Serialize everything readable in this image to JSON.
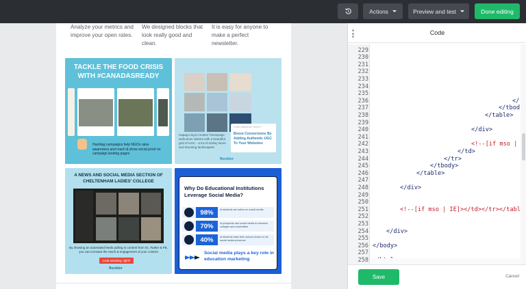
{
  "toolbar": {
    "history_icon": "history-icon",
    "actions_label": "Actions",
    "preview_label": "Preview and test",
    "done_label": "Done editing"
  },
  "email": {
    "intro": [
      "Analyze your metrics and improve your open rates.",
      "We designed blocks that look really good and clean.",
      "It is easy for anyone to make a perfect newsletter."
    ],
    "card1": {
      "title": "TACKLE THE FOOD CRISIS WITH #CANADASREADY",
      "footer": "Hashtag campaigns help NGOs raise awareness and reach & show social proof on campaign landing pages"
    },
    "card2": {
      "text": "Hapag-Lloyd Cruises' homepage welcomes visitors with a beautiful grid of UGC - a lot of smiley faces and stunning landscapes!",
      "box_small": "LOOK AMAZING, RIGHT?",
      "box_title": "Boost Conversions By Adding Authentic UGC To Your Websites",
      "brand": "flockler"
    },
    "card3": {
      "title": "A NEWS AND SOCIAL MEDIA SECTION OF CHELTENHAM LADIES' COLLEGE",
      "text": "By showing an automated feeds pulling in content from IG, Twitter & FB, you can increase the reach & engagement of your content",
      "cta": "Look amazing, right?",
      "brand": "flockler"
    },
    "card4": {
      "title": "Why Do Educational Institutions Leverage Social Media?",
      "stats": [
        {
          "value": "98%",
          "desc": "of students are active on social media"
        },
        {
          "value": "70%",
          "desc": "of prospects use social media to research colleges and universities"
        },
        {
          "value": "40%",
          "desc": "of students base their school choice on its social media presence"
        }
      ],
      "bottom": "Social media plays a key role in education marketing"
    }
  },
  "panel": {
    "title": "Code",
    "save_label": "Save",
    "cancel_label": "Cancel",
    "line_numbers": [
      "229",
      "230",
      "231",
      "232",
      "233",
      "234",
      "235",
      "236",
      "237",
      "238",
      "239",
      "240",
      "241",
      "242",
      "243",
      "244",
      "245",
      "246",
      "247",
      "248",
      "249",
      "250",
      "251",
      "252",
      "253",
      "254",
      "255",
      "256",
      "257",
      "258"
    ],
    "code_lines": [
      "",
      "",
      "",
      "",
      "",
      "",
      "",
      "</",
      "</tbod",
      "</table>",
      "",
      "</div>",
      "",
      "<!--[if mso |",
      "</td>",
      "</tr>",
      "</tbody>",
      "</table>",
      "",
      "</div>",
      "",
      "",
      "<!--[if mso | IE]></td></tr></tabl",
      "",
      "",
      "</div>",
      "",
      "</body>",
      "",
      "</html>"
    ]
  }
}
